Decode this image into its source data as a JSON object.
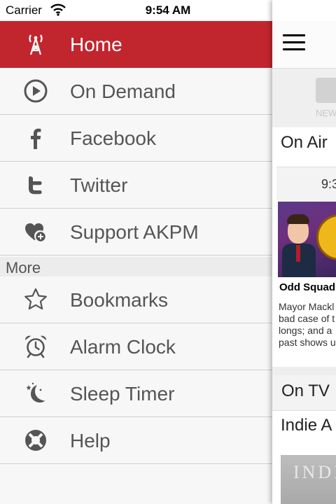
{
  "status_bar": {
    "carrier": "Carrier",
    "time": "9:54 AM"
  },
  "drawer": {
    "items": [
      {
        "label": "Home",
        "icon": "radio-tower-icon",
        "active": true
      },
      {
        "label": "On Demand",
        "icon": "play-circle-icon"
      },
      {
        "label": "Facebook",
        "icon": "facebook-icon"
      },
      {
        "label": "Twitter",
        "icon": "twitter-icon"
      },
      {
        "label": "Support AKPM",
        "icon": "heart-plus-icon"
      }
    ],
    "section_header": "More",
    "more_items": [
      {
        "label": "Bookmarks",
        "icon": "star-icon"
      },
      {
        "label": "Alarm Clock",
        "icon": "alarm-clock-icon"
      },
      {
        "label": "Sleep Timer",
        "icon": "moon-stars-icon"
      },
      {
        "label": "Help",
        "icon": "lifebuoy-icon"
      }
    ]
  },
  "main": {
    "tab_label": "NEWS",
    "on_air_heading": "On Air",
    "card": {
      "time": "9:3",
      "title": "Odd Squad",
      "description_lines": [
        "Mayor Mackl",
        "bad case of t",
        "longs; and a",
        "past shows u"
      ]
    },
    "on_tv_heading": "On TV",
    "indie_heading": "Indie A",
    "indie_image_text": "INDIE"
  },
  "colors": {
    "accent": "#c1262f",
    "drawer_bg": "#f7f7f7",
    "icon_gray": "#555555"
  }
}
